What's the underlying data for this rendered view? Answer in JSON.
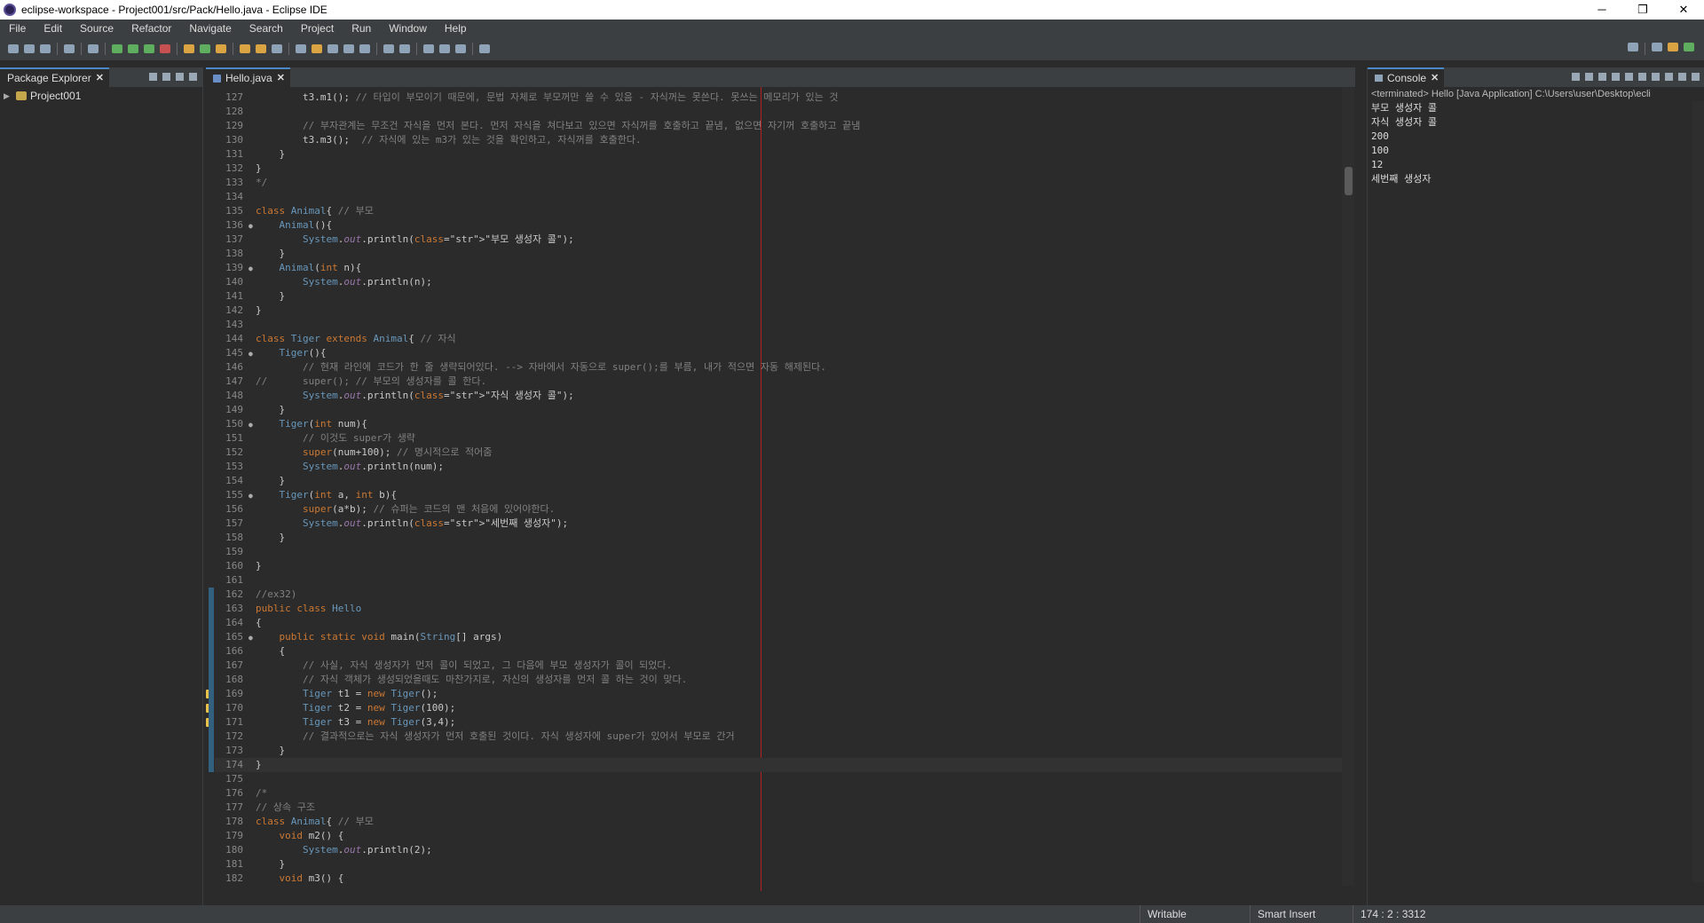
{
  "window": {
    "title": "eclipse-workspace - Project001/src/Pack/Hello.java - Eclipse IDE",
    "controls": [
      "─",
      "❐",
      "✕"
    ]
  },
  "menu": [
    "File",
    "Edit",
    "Source",
    "Refactor",
    "Navigate",
    "Search",
    "Project",
    "Run",
    "Window",
    "Help"
  ],
  "package_explorer": {
    "tab_label": "Package Explorer",
    "project": "Project001"
  },
  "editor": {
    "tab_label": "Hello.java",
    "lines": [
      {
        "n": "127",
        "code": "        t3.m1(); // 타입이 부모이기 때문에, 문법 자체로 부모꺼만 쓸 수 있음 - 자식꺼는 못쓴다. 못쓰는 메모리가 있는 것"
      },
      {
        "n": "128",
        "code": ""
      },
      {
        "n": "129",
        "code": "        // 부자관계는 무조건 자식을 먼저 본다. 먼저 자식을 쳐다보고 있으면 자식꺼를 호출하고 끝냄, 없으면 자기꺼 호출하고 끝냄"
      },
      {
        "n": "130",
        "code": "        t3.m3();  // 자식에 있는 m3가 있는 것을 확인하고, 자식꺼를 호출한다."
      },
      {
        "n": "131",
        "code": "    }"
      },
      {
        "n": "132",
        "code": "}"
      },
      {
        "n": "133",
        "code": "*/"
      },
      {
        "n": "134",
        "code": ""
      },
      {
        "n": "135",
        "code": "class Animal{ // 부모"
      },
      {
        "n": "136",
        "code": "    Animal(){",
        "fold": true
      },
      {
        "n": "137",
        "code": "        System.out.println(\"부모 생성자 콜\");"
      },
      {
        "n": "138",
        "code": "    }"
      },
      {
        "n": "139",
        "code": "    Animal(int n){",
        "fold": true
      },
      {
        "n": "140",
        "code": "        System.out.println(n);"
      },
      {
        "n": "141",
        "code": "    }"
      },
      {
        "n": "142",
        "code": "}"
      },
      {
        "n": "143",
        "code": ""
      },
      {
        "n": "144",
        "code": "class Tiger extends Animal{ // 자식"
      },
      {
        "n": "145",
        "code": "    Tiger(){",
        "fold": true
      },
      {
        "n": "146",
        "code": "        // 현재 라인에 코드가 한 줄 생략되어있다. --> 자바에서 자동으로 super();를 부름, 내가 적으면 자동 해제된다."
      },
      {
        "n": "147",
        "code": "//      super(); // 부모의 생성자를 콜 한다."
      },
      {
        "n": "148",
        "code": "        System.out.println(\"자식 생성자 콜\");"
      },
      {
        "n": "149",
        "code": "    }"
      },
      {
        "n": "150",
        "code": "    Tiger(int num){",
        "fold": true
      },
      {
        "n": "151",
        "code": "        // 이것도 super가 생략"
      },
      {
        "n": "152",
        "code": "        super(num+100); // 명시적으로 적어줌"
      },
      {
        "n": "153",
        "code": "        System.out.println(num);"
      },
      {
        "n": "154",
        "code": "    }"
      },
      {
        "n": "155",
        "code": "    Tiger(int a, int b){",
        "fold": true
      },
      {
        "n": "156",
        "code": "        super(a*b); // 슈퍼는 코드의 맨 처음에 있어야한다."
      },
      {
        "n": "157",
        "code": "        System.out.println(\"세번째 생성자\");"
      },
      {
        "n": "158",
        "code": "    }"
      },
      {
        "n": "159",
        "code": ""
      },
      {
        "n": "160",
        "code": "}"
      },
      {
        "n": "161",
        "code": ""
      },
      {
        "n": "162",
        "code": "//ex32)"
      },
      {
        "n": "163",
        "code": "public class Hello"
      },
      {
        "n": "164",
        "code": "{"
      },
      {
        "n": "165",
        "code": "    public static void main(String[] args)",
        "fold": true
      },
      {
        "n": "166",
        "code": "    {"
      },
      {
        "n": "167",
        "code": "        // 사실, 자식 생성자가 먼저 콜이 되었고, 그 다음에 부모 생성자가 콜이 되었다."
      },
      {
        "n": "168",
        "code": "        // 자식 객체가 생성되었을때도 마찬가지로, 자신의 생성자를 먼저 콜 하는 것이 맞다."
      },
      {
        "n": "169",
        "code": "        Tiger t1 = new Tiger();",
        "warn": true
      },
      {
        "n": "170",
        "code": "        Tiger t2 = new Tiger(100);",
        "warn": true
      },
      {
        "n": "171",
        "code": "        Tiger t3 = new Tiger(3,4);",
        "warn": true
      },
      {
        "n": "172",
        "code": "        // 결과적으로는 자식 생성자가 먼저 호출된 것이다. 자식 생성자에 super가 있어서 부모로 간거"
      },
      {
        "n": "173",
        "code": "    }"
      },
      {
        "n": "174",
        "code": "}",
        "current": true
      },
      {
        "n": "175",
        "code": ""
      },
      {
        "n": "176",
        "code": "/*"
      },
      {
        "n": "177",
        "code": "// 상속 구조"
      },
      {
        "n": "178",
        "code": "class Animal{ // 부모"
      },
      {
        "n": "179",
        "code": "    void m2() {"
      },
      {
        "n": "180",
        "code": "        System.out.println(2);"
      },
      {
        "n": "181",
        "code": "    }"
      },
      {
        "n": "182",
        "code": "    void m3() {"
      }
    ]
  },
  "console": {
    "tab_label": "Console",
    "status": "<terminated> Hello [Java Application] C:\\Users\\user\\Desktop\\ecli",
    "output": [
      "부모 생성자 콜",
      "자식 생성자 콜",
      "200",
      "100",
      "12",
      "세번째 생성자"
    ]
  },
  "statusbar": {
    "writable": "Writable",
    "insert_mode": "Smart Insert",
    "position": "174 : 2 : 3312"
  }
}
